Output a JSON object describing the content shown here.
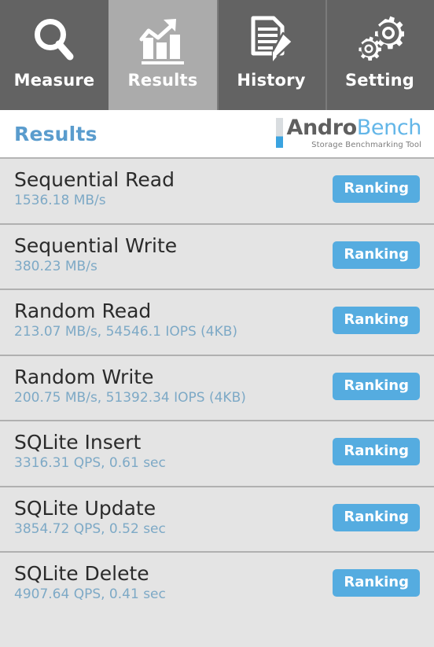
{
  "tabs": [
    {
      "label": "Measure",
      "icon": "magnifier-icon",
      "active": false
    },
    {
      "label": "Results",
      "icon": "bar-chart-icon",
      "active": true
    },
    {
      "label": "History",
      "icon": "document-pencil-icon",
      "active": false
    },
    {
      "label": "Setting",
      "icon": "gears-icon",
      "active": false
    }
  ],
  "header": {
    "title": "Results",
    "logo_primary": "Andro",
    "logo_secondary": "Bench",
    "logo_tagline": "Storage Benchmarking Tool"
  },
  "results": {
    "ranking_label": "Ranking",
    "rows": [
      {
        "title": "Sequential Read",
        "value": "1536.18 MB/s"
      },
      {
        "title": "Sequential Write",
        "value": "380.23 MB/s"
      },
      {
        "title": "Random Read",
        "value": "213.07 MB/s, 54546.1 IOPS (4KB)"
      },
      {
        "title": "Random Write",
        "value": "200.75 MB/s, 51392.34 IOPS (4KB)"
      },
      {
        "title": "SQLite Insert",
        "value": "3316.31 QPS, 0.61 sec"
      },
      {
        "title": "SQLite Update",
        "value": "3854.72 QPS, 0.52 sec"
      },
      {
        "title": "SQLite Delete",
        "value": "4907.64 QPS, 0.41 sec"
      }
    ]
  },
  "colors": {
    "tabbar_background": "#636363",
    "tab_active_background": "#ababab",
    "accent_blue": "#55ace0",
    "title_blue": "#5a9ccd",
    "value_blue": "#7da9c6",
    "list_background": "#e4e4e4",
    "separator": "#b0b0b0"
  }
}
